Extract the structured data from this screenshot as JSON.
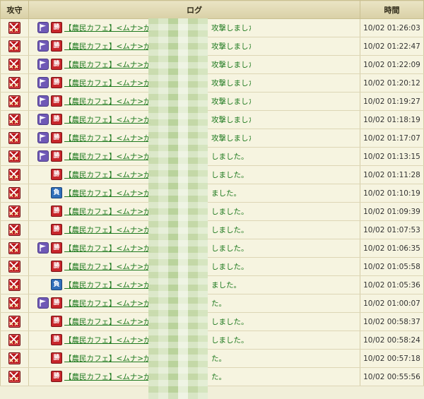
{
  "headers": {
    "type": "攻守",
    "log": "ログ",
    "time": "時間"
  },
  "icons": {
    "type": "crossed-swords-icon",
    "flag": "flag-icon"
  },
  "colors": {
    "win": "#c7262b",
    "lose": "#2f6eb9",
    "link": "#1f7a1f",
    "badge": "#b8161c",
    "flag": "#6f59b6"
  },
  "rows": [
    {
      "flag": true,
      "result": "勝",
      "outcome": "win",
      "text": "【農民カフェ】<ムナ>が",
      "tail": "攻撃しました。",
      "time": "10/02 01:26:03"
    },
    {
      "flag": true,
      "result": "勝",
      "outcome": "win",
      "text": "【農民カフェ】<ムナ>が",
      "tail": "攻撃しました。",
      "time": "10/02 01:22:47"
    },
    {
      "flag": true,
      "result": "勝",
      "outcome": "win",
      "text": "【農民カフェ】<ムナ>が",
      "tail": "攻撃しました。",
      "time": "10/02 01:22:09"
    },
    {
      "flag": true,
      "result": "勝",
      "outcome": "win",
      "text": "【農民カフェ】<ムナ>が",
      "tail": "攻撃しました。",
      "time": "10/02 01:20:12"
    },
    {
      "flag": true,
      "result": "勝",
      "outcome": "win",
      "text": "【農民カフェ】<ムナ>が",
      "tail": "攻撃しました。",
      "time": "10/02 01:19:27"
    },
    {
      "flag": true,
      "result": "勝",
      "outcome": "win",
      "text": "【農民カフェ】<ムナ>が",
      "tail": "攻撃しました。",
      "time": "10/02 01:18:19"
    },
    {
      "flag": true,
      "result": "勝",
      "outcome": "win",
      "text": "【農民カフェ】<ムナ>が",
      "tail": "攻撃しました。",
      "time": "10/02 01:17:07"
    },
    {
      "flag": true,
      "result": "勝",
      "outcome": "win",
      "text": "【農民カフェ】<ムナ>が",
      "tail": "しました。",
      "time": "10/02 01:13:15"
    },
    {
      "flag": false,
      "result": "勝",
      "outcome": "win",
      "text": "【農民カフェ】<ムナ>が",
      "tail": "しました。",
      "time": "10/02 01:11:28"
    },
    {
      "flag": false,
      "result": "負",
      "outcome": "lose",
      "text": "【農民カフェ】<ムナ>が",
      "tail": "ました。",
      "time": "10/02 01:10:19"
    },
    {
      "flag": false,
      "result": "勝",
      "outcome": "win",
      "text": "【農民カフェ】<ムナ>が",
      "tail": "しました。",
      "time": "10/02 01:09:39"
    },
    {
      "flag": false,
      "result": "勝",
      "outcome": "win",
      "text": "【農民カフェ】<ムナ>が",
      "tail": "しました。",
      "time": "10/02 01:07:53"
    },
    {
      "flag": true,
      "result": "勝",
      "outcome": "win",
      "text": "【農民カフェ】<ムナ>が",
      "tail": "しました。",
      "time": "10/02 01:06:35"
    },
    {
      "flag": false,
      "result": "勝",
      "outcome": "win",
      "text": "【農民カフェ】<ムナ>が",
      "tail": "しました。",
      "time": "10/02 01:05:58"
    },
    {
      "flag": false,
      "result": "負",
      "outcome": "lose",
      "text": "【農民カフェ】<ムナ>が",
      "tail": "ました。",
      "time": "10/02 01:05:36"
    },
    {
      "flag": true,
      "result": "勝",
      "outcome": "win",
      "text": "【農民カフェ】<ムナ>が",
      "tail": "た。",
      "time": "10/02 01:00:07"
    },
    {
      "flag": false,
      "result": "勝",
      "outcome": "win",
      "text": "【農民カフェ】<ムナ>が",
      "tail": "しました。",
      "time": "10/02 00:58:37"
    },
    {
      "flag": false,
      "result": "勝",
      "outcome": "win",
      "text": "【農民カフェ】<ムナ>が",
      "tail": "しました。",
      "time": "10/02 00:58:24"
    },
    {
      "flag": false,
      "result": "勝",
      "outcome": "win",
      "text": "【農民カフェ】<ムナ>が",
      "tail": "た。",
      "time": "10/02 00:57:18"
    },
    {
      "flag": false,
      "result": "勝",
      "outcome": "win",
      "text": "【農民カフェ】<ムナ>が",
      "tail": "た。",
      "time": "10/02 00:55:56"
    }
  ]
}
